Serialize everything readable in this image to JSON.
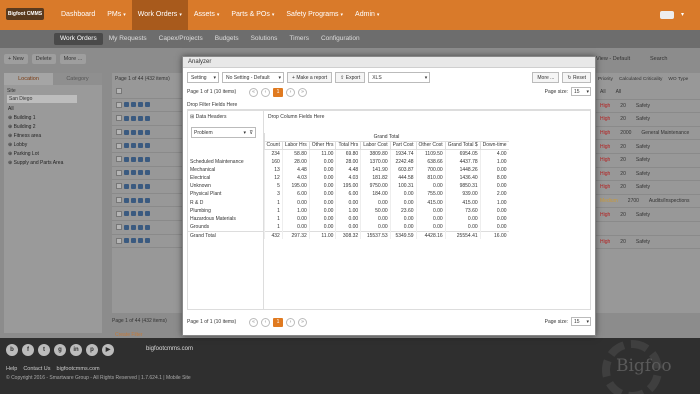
{
  "topnav": {
    "logo": "Bigfoot CMMS",
    "items": [
      {
        "label": "Dashboard",
        "caret": false
      },
      {
        "label": "PMs",
        "caret": true
      },
      {
        "label": "Work Orders",
        "caret": true
      },
      {
        "label": "Assets",
        "caret": true
      },
      {
        "label": "Parts & POs",
        "caret": true
      },
      {
        "label": "Safety Programs",
        "caret": true
      },
      {
        "label": "Admin",
        "caret": true
      }
    ]
  },
  "subnav": {
    "items": [
      "Work Orders",
      "My Requests",
      "Capex/Projects",
      "Budgets",
      "Solutions",
      "Timers",
      "Configuration"
    ]
  },
  "page": {
    "toolbar": [
      "+ New",
      "Delete",
      "More ..."
    ],
    "left_tabs": [
      "Location",
      "Category"
    ],
    "site_label": "Site",
    "site_value": "San Diego",
    "tree": [
      "All",
      "Building 1",
      "Building 2",
      "Fitness area",
      "Lobby",
      "Parking Lot",
      "Supply and Parts Area"
    ],
    "pager": "Page 1 of 44 (432 items)",
    "view": "View - Default",
    "search": "Search",
    "right_headers": [
      "Priority",
      "Calculated Criticality",
      "WO Type"
    ],
    "right_filters": [
      "All",
      "All"
    ],
    "right_rows": [
      {
        "priority": "High",
        "crit": "20",
        "type": "Safety",
        "level": "hi"
      },
      {
        "priority": "High",
        "crit": "20",
        "type": "Safety",
        "level": "hi"
      },
      {
        "priority": "High",
        "crit": "2000",
        "type": "General Maintenance",
        "level": "hi"
      },
      {
        "priority": "High",
        "crit": "20",
        "type": "Safety",
        "level": "hi"
      },
      {
        "priority": "High",
        "crit": "20",
        "type": "Safety",
        "level": "hi"
      },
      {
        "priority": "High",
        "crit": "20",
        "type": "Safety",
        "level": "hi"
      },
      {
        "priority": "High",
        "crit": "20",
        "type": "Safety",
        "level": "hi"
      },
      {
        "priority": "Medium",
        "crit": "2700",
        "type": "Audits/Inspections",
        "level": "med"
      },
      {
        "priority": "High",
        "crit": "20",
        "type": "Safety",
        "level": "hi"
      },
      {
        "priority": "",
        "crit": "",
        "type": "",
        "level": "hi"
      },
      {
        "priority": "High",
        "crit": "20",
        "type": "Safety",
        "level": "hi"
      }
    ],
    "bottom_pager": "Page 1 of 44 (432 items)",
    "create_filter": "Create Filter"
  },
  "footer": {
    "site": "bigfootcmms.com",
    "links": [
      "Help",
      "Contact Us",
      "bigfootcmms.com"
    ],
    "copyright": "© Copyright 2016 - Smartware Group - All Rights Reserved | 1.7.624.1 | Mobile Site",
    "brand": "Bigfoo"
  },
  "dialog": {
    "title": "Analyzer",
    "setting_label": "Setting",
    "no_setting": "No Setting - Default",
    "make_report": "Make a report",
    "export_label": "Export",
    "export_format": "XLS",
    "more": "More ...",
    "reset": "Reset",
    "pager_text": "Page 1 of 1 (10 items)",
    "current_page": "1",
    "page_size_label": "Page size:",
    "page_size": "15",
    "drop_filter": "Drop Filter Fields Here",
    "data_headers": "Data Headers",
    "drop_column": "Drop Column Fields Here",
    "row_field": "Problem",
    "grand_total_header": "Grand Total",
    "columns": [
      "Count",
      "Labor Hrs",
      "Other Hrs",
      "Total Hrs",
      "Labor Cost",
      "Part Cost",
      "Other Cost",
      "Grand Total $",
      "Down-time"
    ],
    "rows": [
      {
        "name": "",
        "values": [
          "234",
          "58.80",
          "11.00",
          "69.80",
          "3809.80",
          "1934.74",
          "1109.50",
          "6954.05",
          "4.00"
        ]
      },
      {
        "name": "Scheduled Maintenance",
        "values": [
          "160",
          "28.00",
          "0.00",
          "28.00",
          "1370.00",
          "2242.48",
          "638.66",
          "4437.78",
          "1.00"
        ]
      },
      {
        "name": "Mechanical",
        "values": [
          "13",
          "4.48",
          "0.00",
          "4.48",
          "141.90",
          "603.87",
          "700.00",
          "1448.26",
          "0.00"
        ]
      },
      {
        "name": "Electrical",
        "values": [
          "12",
          "4.03",
          "0.00",
          "4.03",
          "181.82",
          "444.58",
          "810.00",
          "1436.40",
          "8.00"
        ]
      },
      {
        "name": "Unknown",
        "values": [
          "5",
          "195.00",
          "0.00",
          "195.00",
          "9750.00",
          "100.31",
          "0.00",
          "9850.31",
          "0.00"
        ]
      },
      {
        "name": "Physical Plant",
        "values": [
          "3",
          "6.00",
          "0.00",
          "6.00",
          "184.00",
          "0.00",
          "755.00",
          "939.00",
          "2.00"
        ]
      },
      {
        "name": "R & D",
        "values": [
          "1",
          "0.00",
          "0.00",
          "0.00",
          "0.00",
          "0.00",
          "415.00",
          "415.00",
          "1.00"
        ]
      },
      {
        "name": "Plumbing",
        "values": [
          "1",
          "1.00",
          "0.00",
          "1.00",
          "50.00",
          "23.60",
          "0.00",
          "73.60",
          "0.00"
        ]
      },
      {
        "name": "Hazardous Materials",
        "values": [
          "1",
          "0.00",
          "0.00",
          "0.00",
          "0.00",
          "0.00",
          "0.00",
          "0.00",
          "0.00"
        ]
      },
      {
        "name": "Grounds",
        "values": [
          "1",
          "0.00",
          "0.00",
          "0.00",
          "0.00",
          "0.00",
          "0.00",
          "0.00",
          "0.00"
        ]
      }
    ],
    "grand_total": {
      "name": "Grand Total",
      "values": [
        "432",
        "297.32",
        "11.00",
        "308.32",
        "15537.53",
        "5349.59",
        "4428.16",
        "25554.41",
        "16.00"
      ]
    }
  }
}
